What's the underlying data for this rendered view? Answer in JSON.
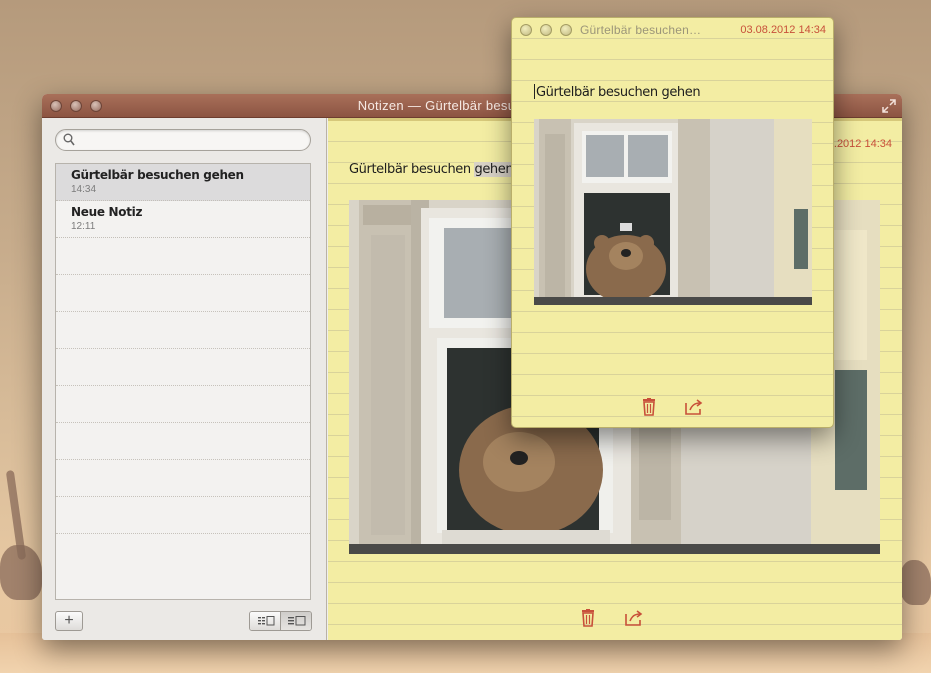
{
  "desktop": {},
  "main_window": {
    "title": "Notizen — Gürtelbär besuchen gehen",
    "search": {
      "value": "",
      "placeholder": ""
    },
    "notes": [
      {
        "title": "Gürtelbär besuchen gehen",
        "time": "14:34",
        "selected": true
      },
      {
        "title": "Neue Notiz",
        "time": "12:11",
        "selected": false
      }
    ],
    "add_label": "+",
    "note": {
      "heading_plain": "Gürtelbär besuchen ",
      "heading_highlight": "gehen",
      "date": "03.08.2012 14:34"
    }
  },
  "floating_window": {
    "title": "Gürtelbär besuchen…",
    "date": "03.08.2012 14:34",
    "heading": "Gürtelbär besuchen gehen"
  },
  "icons": {
    "trash": "trash-icon",
    "share": "share-icon",
    "search": "search-icon",
    "fullscreen": "fullscreen-icon",
    "list_view": "list-view-icon",
    "split_view": "split-view-icon"
  },
  "colors": {
    "accent_red": "#c8503a",
    "paper_yellow": "#f3eda3",
    "titlebar_brown": "#9c604c"
  }
}
